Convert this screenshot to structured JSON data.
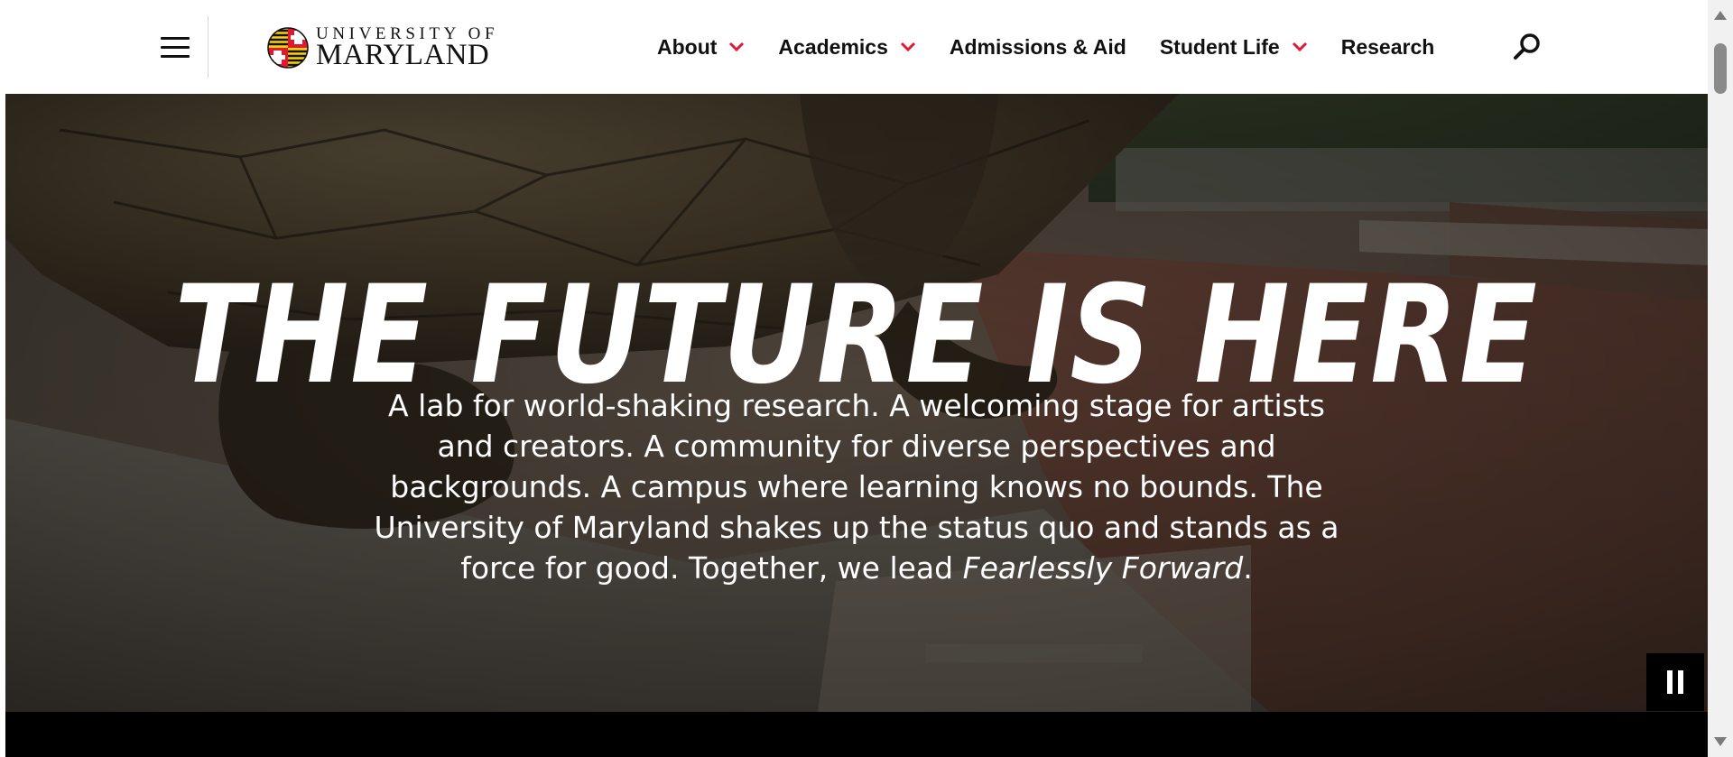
{
  "header": {
    "logo": {
      "line1": "UNIVERSITY OF",
      "line2": "MARYLAND"
    },
    "nav": [
      {
        "label": "About",
        "has_dropdown": true
      },
      {
        "label": "Academics",
        "has_dropdown": true
      },
      {
        "label": "Admissions & Aid",
        "has_dropdown": false
      },
      {
        "label": "Student Life",
        "has_dropdown": true
      },
      {
        "label": "Research",
        "has_dropdown": false
      }
    ],
    "menu_icon": "hamburger-icon",
    "search_icon": "search-icon"
  },
  "hero": {
    "title": "THE FUTURE IS HERE",
    "body": "A lab for world-shaking research. A welcoming stage for artists and creators. A community for diverse perspectives and backgrounds. A campus where learning knows no bounds. The University of Maryland shakes up the status quo and stands as a force for good. Together, we lead",
    "body_emphasis": "Fearlessly Forward",
    "body_end": ".",
    "pause_icon": "pause-icon"
  },
  "colors": {
    "brand_red": "#e21833",
    "brand_gold": "#ffd200",
    "header_bg": "#ffffff",
    "text_dark": "#111111"
  }
}
